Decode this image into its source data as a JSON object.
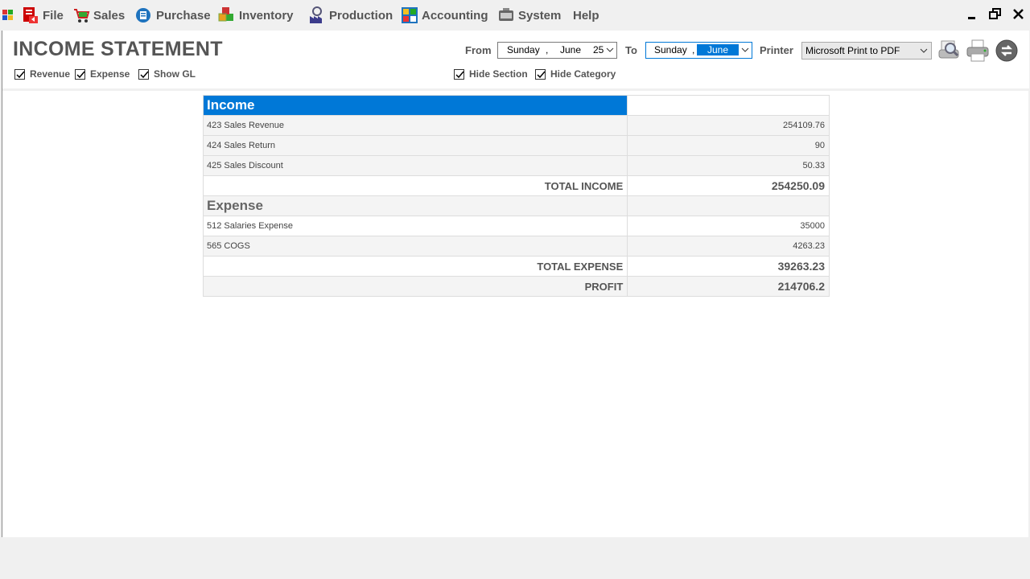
{
  "menu": {
    "items": [
      {
        "label": "File",
        "icon": "file-icon"
      },
      {
        "label": "Sales",
        "icon": "cart-icon"
      },
      {
        "label": "Purchase",
        "icon": "purchase-icon"
      },
      {
        "label": "Inventory",
        "icon": "boxes-icon"
      },
      {
        "label": "Production",
        "icon": "factory-icon"
      },
      {
        "label": "Accounting",
        "icon": "calculator-icon"
      },
      {
        "label": "System",
        "icon": "system-icon"
      },
      {
        "label": "Help",
        "icon": ""
      }
    ]
  },
  "header": {
    "title": "INCOME STATEMENT",
    "from_label": "From",
    "to_label": "To",
    "printer_label": "Printer",
    "from_date": {
      "day": "Sunday",
      "sep": ",",
      "month": "June",
      "date": "25"
    },
    "to_date": {
      "day": "Sunday",
      "sep": ",",
      "month": "June"
    },
    "printer": "Microsoft Print to PDF"
  },
  "options": {
    "revenue": "Revenue",
    "expense": "Expense",
    "show_gl": "Show GL",
    "hide_section": "Hide Section",
    "hide_category": "Hide Category"
  },
  "report": {
    "income_section": "Income",
    "income_rows": [
      {
        "account": "423 Sales Revenue",
        "amount": "254109.76"
      },
      {
        "account": "424 Sales Return",
        "amount": "90"
      },
      {
        "account": "425 Sales Discount",
        "amount": "50.33"
      }
    ],
    "total_income_label": "TOTAL INCOME",
    "total_income": "254250.09",
    "expense_section": "Expense",
    "expense_rows": [
      {
        "account": "512 Salaries Expense",
        "amount": "35000"
      },
      {
        "account": "565 COGS",
        "amount": "4263.23"
      }
    ],
    "total_expense_label": "TOTAL EXPENSE",
    "total_expense": "39263.23",
    "profit_label": "PROFIT",
    "profit": "214706.2"
  },
  "colors": {
    "accent": "#0078d7",
    "text": "#555555"
  }
}
